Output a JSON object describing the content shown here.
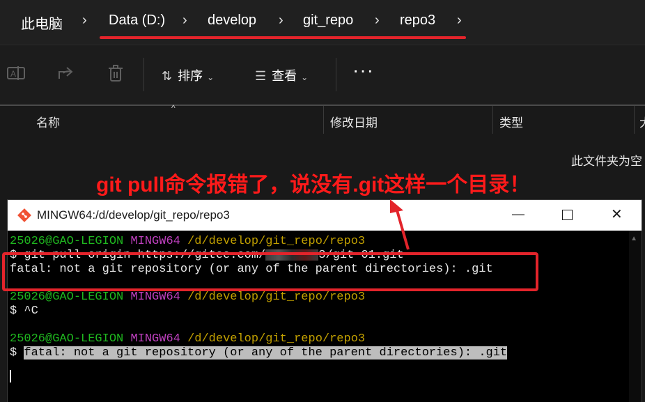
{
  "breadcrumb": {
    "items": [
      "此电脑",
      "Data (D:)",
      "develop",
      "git_repo",
      "repo3"
    ],
    "separator": "›",
    "highlight_color": "#e3242b"
  },
  "toolbar": {
    "icons": [
      "rename-icon",
      "share-icon",
      "delete-icon"
    ],
    "sort_label": "排序",
    "view_label": "查看",
    "more_label": "···"
  },
  "columns": [
    "名称",
    "修改日期",
    "类型",
    "大"
  ],
  "empty_message": "此文件夹为空",
  "annotation": {
    "text": "git pull命令报错了，说没有.git这样一个目录！",
    "color": "#ff1a1a"
  },
  "terminal": {
    "title": "MINGW64:/d/develop/git_repo/repo3",
    "user": "25026@GAO-LEGION",
    "env": "MINGW64",
    "path": "/d/develop/git_repo/repo3",
    "lines": {
      "cmd1_prefix": "$ git pull origin https://gitee.com/",
      "cmd1_suffix": "3/git-01.git",
      "err1": "fatal: not a git repository (or any of the parent directories): .git",
      "cmd2": "$ ^C",
      "prompt3": "$ ",
      "err3": "fatal: not a git repository (or any of the parent directories): .git"
    }
  }
}
